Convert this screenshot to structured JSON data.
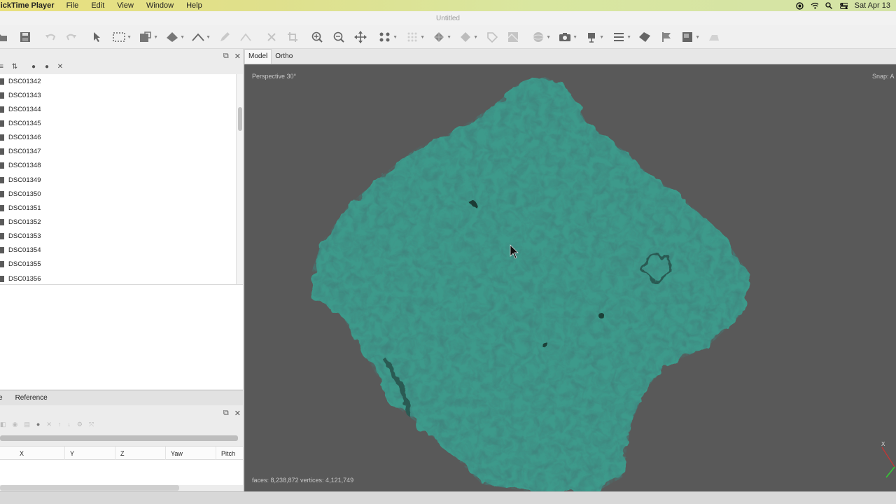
{
  "menubar": {
    "app_name": "uickTime Player",
    "items": [
      "File",
      "Edit",
      "View",
      "Window",
      "Help"
    ],
    "clock": "Sat Apr 13"
  },
  "window": {
    "title": "Untitled"
  },
  "toolbar": {
    "icons": [
      "open-icon",
      "save-icon",
      "undo-icon",
      "redo-icon",
      "select-icon",
      "rect-select-icon",
      "lasso-icon",
      "shape-icon",
      "ruler-icon",
      "pencil-icon",
      "polyline-icon",
      "delete-icon",
      "crop-icon",
      "zoom-in-icon",
      "zoom-out-icon",
      "move-icon",
      "points-icon",
      "grid-icon",
      "mesh-icon",
      "diamond-icon",
      "tag-icon",
      "texture-icon",
      "sphere-icon",
      "camera-icon",
      "marker-icon",
      "list-icon",
      "shape-tool-icon",
      "flag-icon",
      "image-icon",
      "erase-icon"
    ]
  },
  "photos_panel": {
    "files": [
      "DSC01342",
      "DSC01343",
      "DSC01344",
      "DSC01345",
      "DSC01346",
      "DSC01347",
      "DSC01348",
      "DSC01349",
      "DSC01350",
      "DSC01351",
      "DSC01352",
      "DSC01353",
      "DSC01354",
      "DSC01355",
      "DSC01356"
    ]
  },
  "bottom_tabs": {
    "partial": "e",
    "reference": "Reference"
  },
  "reference_table": {
    "columns": [
      "X",
      "Y",
      "Z",
      "Yaw",
      "Pitch"
    ]
  },
  "viewport": {
    "tabs": [
      "Model",
      "Ortho"
    ],
    "projection": "Perspective 30°",
    "snap": "Snap: A",
    "stats": "faces: 8,238,872 vertices: 4,121,749",
    "axis_label": "X"
  },
  "colors": {
    "model_teal": "#3f9f90",
    "viewport_bg": "#595959"
  }
}
